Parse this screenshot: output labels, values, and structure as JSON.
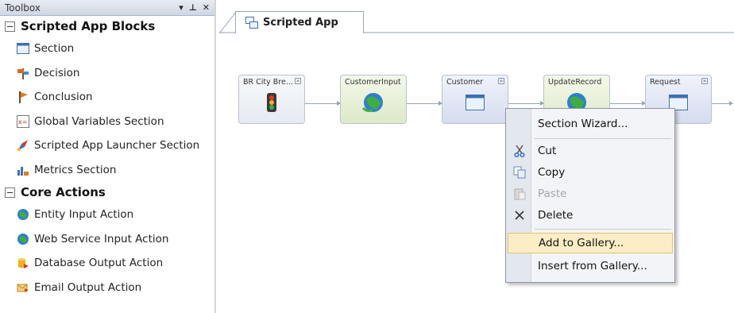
{
  "toolbox": {
    "title": "Toolbox",
    "pin": "▾ ⊥",
    "close": "✕",
    "groups": [
      {
        "label": "Scripted App Blocks",
        "items": [
          "Section",
          "Decision",
          "Conclusion",
          "Global Variables Section",
          "Scripted App Launcher Section",
          "Metrics Section"
        ]
      },
      {
        "label": "Core Actions",
        "items": [
          "Entity Input Action",
          "Web Service Input Action",
          "Database Output Action",
          "Email Output Action"
        ]
      }
    ]
  },
  "document": {
    "tab_label": "Scripted App"
  },
  "canvas": {
    "nodes": [
      "BR City Bre...",
      "CustomerInput",
      "Customer",
      "UpdateRecord",
      "Request"
    ]
  },
  "context_menu": {
    "items": [
      {
        "label": "Section Wizard...",
        "icon": "none",
        "state": "enabled"
      },
      {
        "label": "Cut",
        "icon": "scissors-icon",
        "state": "enabled"
      },
      {
        "label": "Copy",
        "icon": "copy-icon",
        "state": "enabled"
      },
      {
        "label": "Paste",
        "icon": "paste-icon",
        "state": "disabled"
      },
      {
        "label": "Delete",
        "icon": "delete-icon",
        "state": "enabled"
      },
      {
        "label": "Add to Gallery...",
        "icon": "none",
        "state": "highlighted"
      },
      {
        "label": "Insert from Gallery...",
        "icon": "none",
        "state": "enabled"
      }
    ]
  },
  "colors": {
    "menu_highlight": "#fbeec6",
    "menu_highlight_border": "#e3c26a",
    "toolbox_header": "#cfd6e3"
  }
}
